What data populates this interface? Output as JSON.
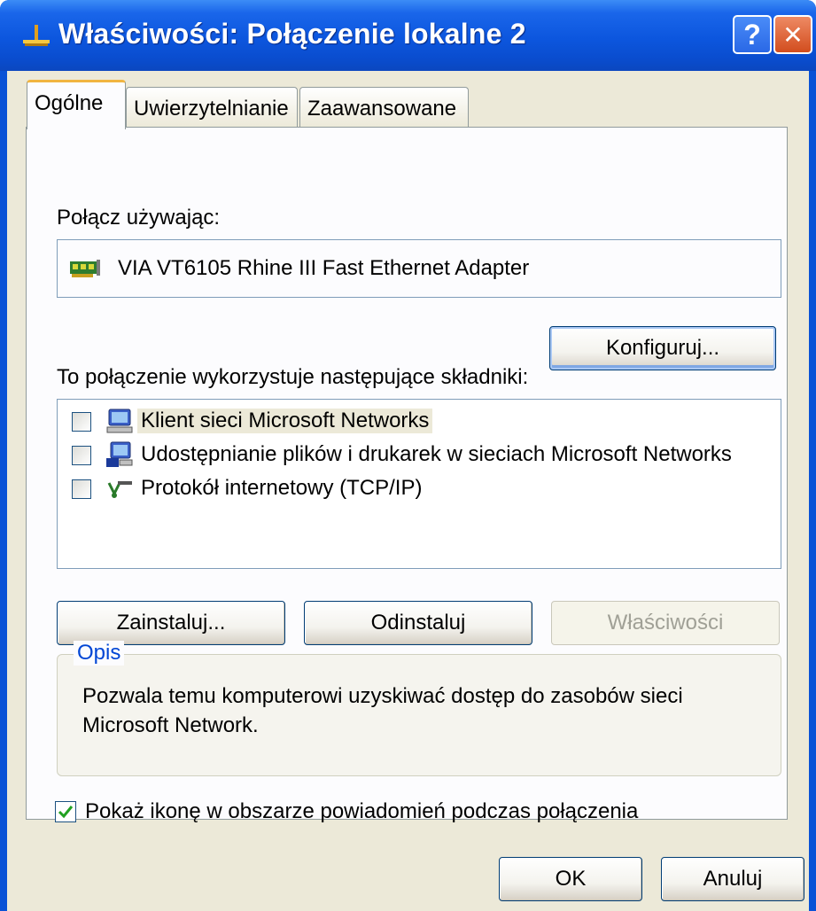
{
  "window": {
    "title": "Właściwości: Połączenie lokalne 2",
    "help_glyph": "?",
    "close_glyph": "✕",
    "title_icon": "network-connection-icon"
  },
  "tabs": [
    {
      "label": "Ogólne",
      "active": true
    },
    {
      "label": "Uwierzytelnianie",
      "active": false
    },
    {
      "label": "Zaawansowane",
      "active": false
    }
  ],
  "general": {
    "connect_using_label": "Połącz używając:",
    "adapter_name": "VIA VT6105 Rhine III Fast Ethernet Adapter",
    "adapter_icon": "network-card-icon",
    "configure_button": "Konfiguruj...",
    "components_label": "To połączenie wykorzystuje następujące składniki:",
    "components": [
      {
        "label": "Klient sieci Microsoft Networks",
        "checked": false,
        "selected": true,
        "icon": "network-client-icon"
      },
      {
        "label": "Udostępnianie plików i drukarek w sieciach Microsoft Networks",
        "checked": false,
        "selected": false,
        "icon": "file-printer-sharing-icon"
      },
      {
        "label": "Protokół internetowy (TCP/IP)",
        "checked": false,
        "selected": false,
        "icon": "protocol-icon"
      }
    ],
    "install_button": "Zainstaluj...",
    "uninstall_button": "Odinstaluj",
    "properties_button": "Właściwości",
    "description_title": "Opis",
    "description_text": "Pozwala temu komputerowi uzyskiwać dostęp do zasobów sieci Microsoft Network.",
    "show_icon_label": "Pokaż ikonę w obszarze powiadomień podczas połączenia",
    "show_icon_checked": true
  },
  "footer": {
    "ok_button": "OK",
    "cancel_button": "Anuluj"
  },
  "colors": {
    "titlebar": "#0a52d6",
    "face": "#ece9d8",
    "group_title": "#0046d5",
    "check_green": "#21a121"
  }
}
